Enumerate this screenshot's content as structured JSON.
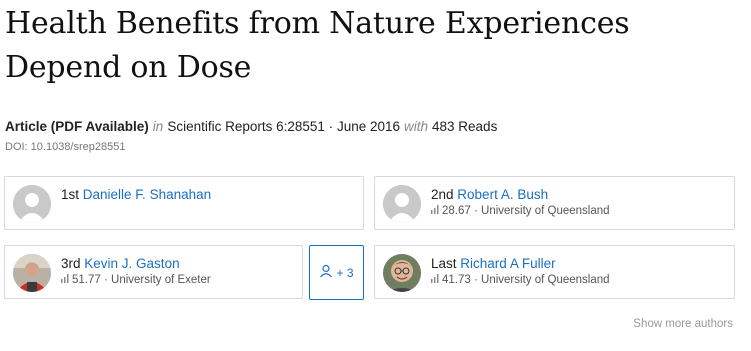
{
  "article": {
    "title": "Health Benefits from Nature Experiences Depend on Dose",
    "type": "Article (PDF Available)",
    "in_word": "in",
    "journal": "Scientific Reports 6:28551",
    "separator": "·",
    "date": "June 2016",
    "with_word": "with",
    "reads": "483 Reads",
    "doi": "DOI: 10.1038/srep28551"
  },
  "authors": [
    {
      "position": "1st",
      "name": "Danielle F. Shanahan",
      "score": "",
      "affiliation": "",
      "avatar": "placeholder-avatar"
    },
    {
      "position": "2nd",
      "name": "Robert A. Bush",
      "score": "28.67",
      "affiliation": "University of Queensland",
      "avatar": "placeholder-avatar"
    },
    {
      "position": "3rd",
      "name": "Kevin J. Gaston",
      "score": "51.77",
      "affiliation": "University of Exeter",
      "avatar": "photo-avatar"
    },
    {
      "position": "Last",
      "name": "Richard A Fuller",
      "score": "41.73",
      "affiliation": "University of Queensland",
      "avatar": "photo-avatar"
    }
  ],
  "more_authors_button": {
    "label": "+ 3",
    "icon": "user-icon"
  },
  "show_more_authors": "Show more authors",
  "colors": {
    "link": "#1a6fc4",
    "border": "#d8d8d8",
    "muted": "#999999"
  }
}
